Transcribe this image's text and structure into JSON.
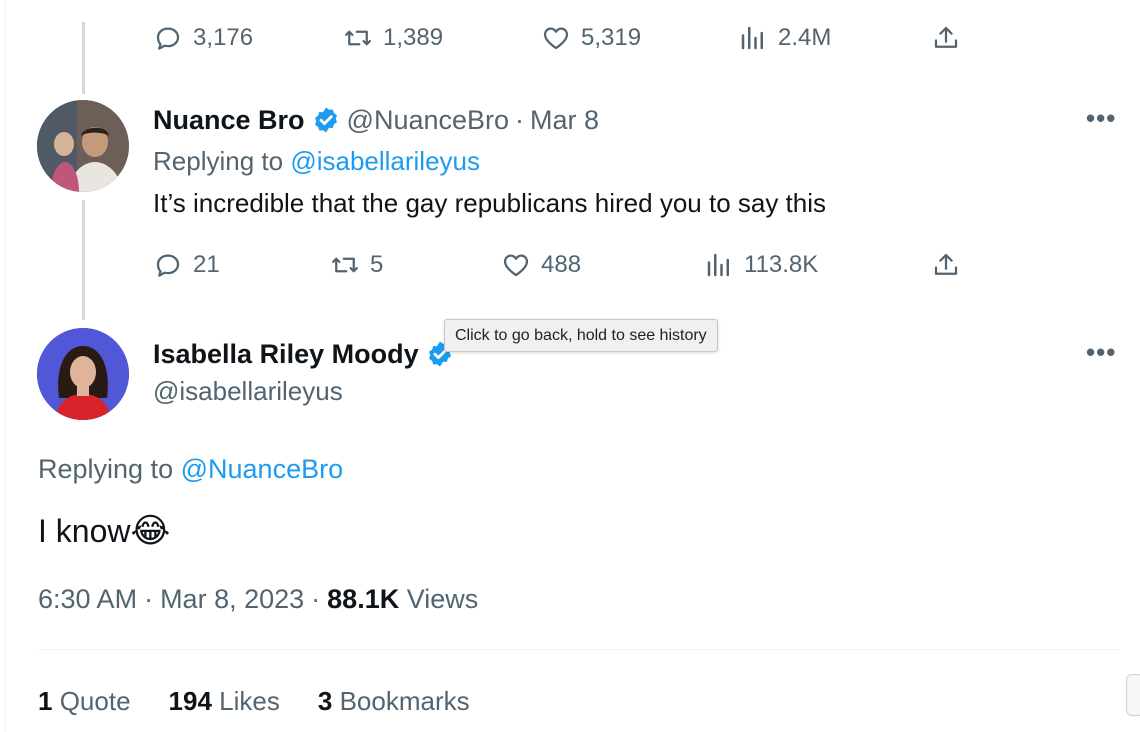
{
  "top_actions": {
    "replies": "3,176",
    "retweets": "1,389",
    "likes": "5,319",
    "views": "2.4M"
  },
  "reply_tweet": {
    "name": "Nuance Bro",
    "handle": "@NuanceBro",
    "sep": "·",
    "date": "Mar 8",
    "replying_label": "Replying to",
    "replying_to": "@isabellarileyus",
    "text": "It’s incredible that the gay republicans hired you to say this",
    "replies": "21",
    "retweets": "5",
    "likes": "488",
    "views": "113.8K"
  },
  "tooltip": "Click to go back, hold to see history",
  "main_tweet": {
    "name": "Isabella Riley Moody",
    "handle": "@isabellarileyus",
    "replying_label": "Replying to",
    "replying_to": "@NuanceBro",
    "text": "I know",
    "emoji": "😂",
    "time": "6:30 AM",
    "sep": "·",
    "date": "Mar 8, 2023",
    "views_count": "88.1K",
    "views_label": "Views",
    "quotes_count": "1",
    "quotes_label": "Quote",
    "likes_count": "194",
    "likes_label": "Likes",
    "bookmarks_count": "3",
    "bookmarks_label": "Bookmarks"
  },
  "colors": {
    "accent": "#1d9bf0",
    "text": "#0f1419",
    "muted": "#536471"
  },
  "icons": [
    "reply-icon",
    "retweet-icon",
    "like-icon",
    "views-icon",
    "share-icon",
    "verified-icon",
    "more-icon"
  ]
}
